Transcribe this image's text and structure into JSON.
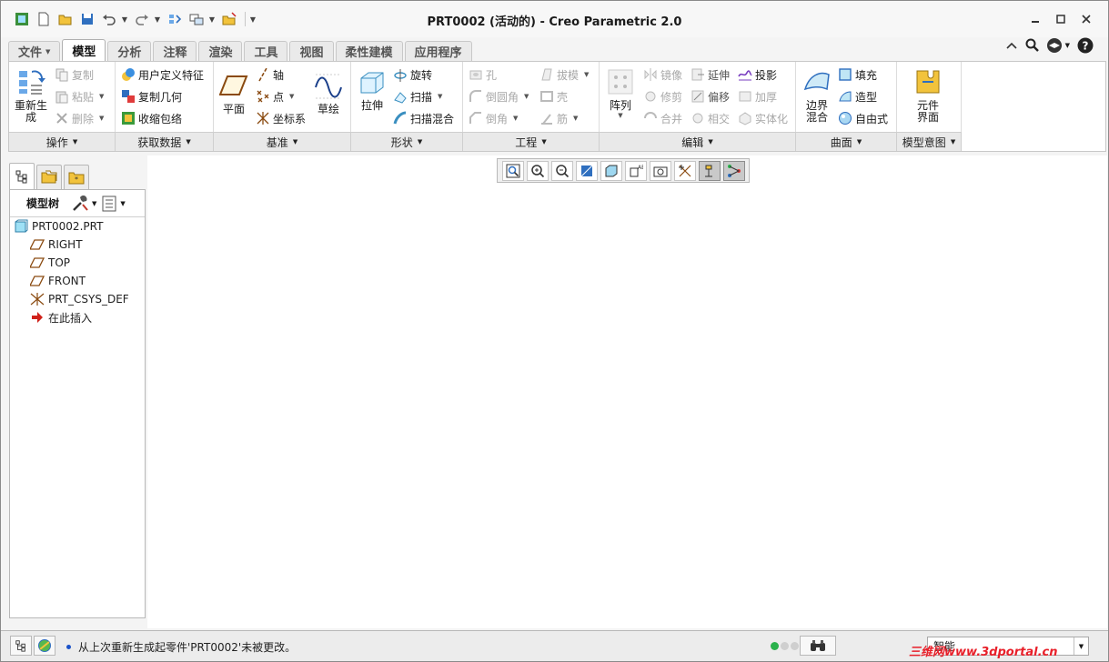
{
  "window": {
    "title": "PRT0002 (活动的) - Creo Parametric 2.0"
  },
  "colors": {
    "accent": "#1a6fd1",
    "tab_active_bg": "#ffffff",
    "status_green": "#2bb24c",
    "watermark_red": "#e8202a"
  },
  "quick_access": {
    "icons": [
      "app-icon",
      "new-icon",
      "open-icon",
      "save-icon",
      "undo-icon",
      "redo-icon",
      "regenerate-icon",
      "windows-icon",
      "close-window-icon",
      "customize-icon"
    ]
  },
  "ribbon_tabs": [
    {
      "label": "文件",
      "has_dropdown": true
    },
    {
      "label": "模型",
      "active": true
    },
    {
      "label": "分析"
    },
    {
      "label": "注释"
    },
    {
      "label": "渲染"
    },
    {
      "label": "工具"
    },
    {
      "label": "视图"
    },
    {
      "label": "柔性建模"
    },
    {
      "label": "应用程序"
    }
  ],
  "groups": {
    "operations": {
      "footer": "操作",
      "regenerate": "重新生成",
      "copy": "复制",
      "paste": "粘贴",
      "delete": "删除"
    },
    "get_data": {
      "footer": "获取数据",
      "udf": "用户定义特征",
      "copy_geom": "复制几何",
      "shrinkwrap": "收缩包络"
    },
    "datum": {
      "footer": "基准",
      "plane": "平面",
      "axis": "轴",
      "point": "点",
      "csys": "坐标系",
      "sketch": "草绘"
    },
    "shapes": {
      "footer": "形状",
      "extrude": "拉伸",
      "revolve": "旋转",
      "sweep": "扫描",
      "swept_blend": "扫描混合"
    },
    "engineering": {
      "footer": "工程",
      "hole": "孔",
      "round": "倒圆角",
      "chamfer": "倒角",
      "draft": "拔模",
      "shell": "壳",
      "rib": "筋"
    },
    "editing": {
      "footer": "编辑",
      "pattern": "阵列",
      "mirror": "镜像",
      "trim": "修剪",
      "merge": "合并",
      "extend": "延伸",
      "offset": "偏移",
      "intersect": "相交",
      "project": "投影",
      "thicken": "加厚",
      "solidify": "实体化"
    },
    "surfaces": {
      "footer": "曲面",
      "boundary_blend": "边界混合",
      "fill": "填充",
      "style": "造型",
      "freestyle": "自由式"
    },
    "model_intent": {
      "footer": "模型意图",
      "component_interface": "元件界面"
    }
  },
  "model_tree": {
    "header": "模型树",
    "nodes": [
      {
        "label": "PRT0002.PRT",
        "icon": "part-icon"
      },
      {
        "label": "RIGHT",
        "icon": "datum-plane-icon"
      },
      {
        "label": "TOP",
        "icon": "datum-plane-icon"
      },
      {
        "label": "FRONT",
        "icon": "datum-plane-icon"
      },
      {
        "label": "PRT_CSYS_DEF",
        "icon": "csys-icon"
      },
      {
        "label": "在此插入",
        "icon": "insert-arrow-icon"
      }
    ]
  },
  "status": {
    "message": "从上次重新生成起零件'PRT0002'未被更改。",
    "filter_value": "智能"
  },
  "watermark": {
    "text": "三维网www.3dportal.cn"
  }
}
